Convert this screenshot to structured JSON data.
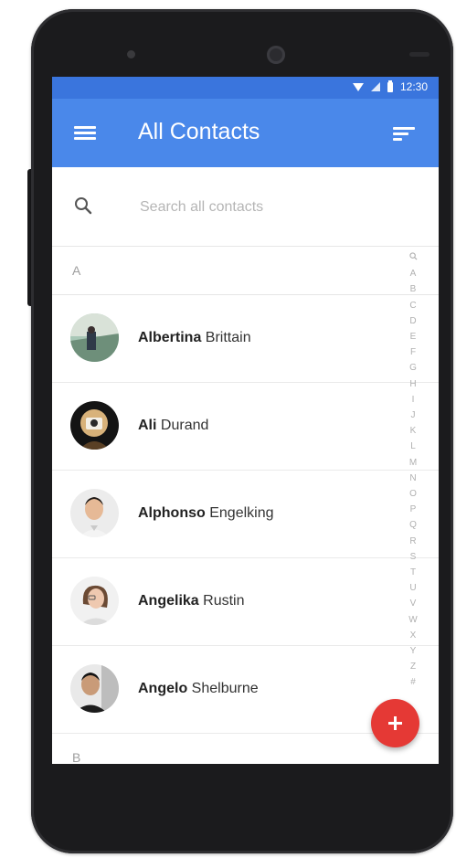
{
  "status_bar": {
    "time": "12:30"
  },
  "app_bar": {
    "title": "All Contacts",
    "menu_icon": "menu-icon",
    "sort_icon": "sort-icon"
  },
  "search": {
    "placeholder": "Search all contacts",
    "value": "",
    "icon": "search-icon"
  },
  "sections": [
    {
      "letter": "A",
      "contacts": [
        {
          "first": "Albertina",
          "last": "Brittain"
        },
        {
          "first": "Ali",
          "last": "Durand"
        },
        {
          "first": "Alphonso",
          "last": "Engelking"
        },
        {
          "first": "Angelika",
          "last": "Rustin"
        },
        {
          "first": "Angelo",
          "last": "Shelburne"
        }
      ]
    },
    {
      "letter": "B",
      "contacts": []
    }
  ],
  "alphabet_index": [
    "A",
    "B",
    "C",
    "D",
    "E",
    "F",
    "G",
    "H",
    "I",
    "J",
    "K",
    "L",
    "M",
    "N",
    "O",
    "P",
    "Q",
    "R",
    "S",
    "T",
    "U",
    "V",
    "W",
    "X",
    "Y",
    "Z",
    "#"
  ],
  "fab": {
    "icon": "add-icon"
  },
  "colors": {
    "status_bar": "#3a75dd",
    "app_bar": "#4a88ea",
    "fab": "#e53935"
  }
}
